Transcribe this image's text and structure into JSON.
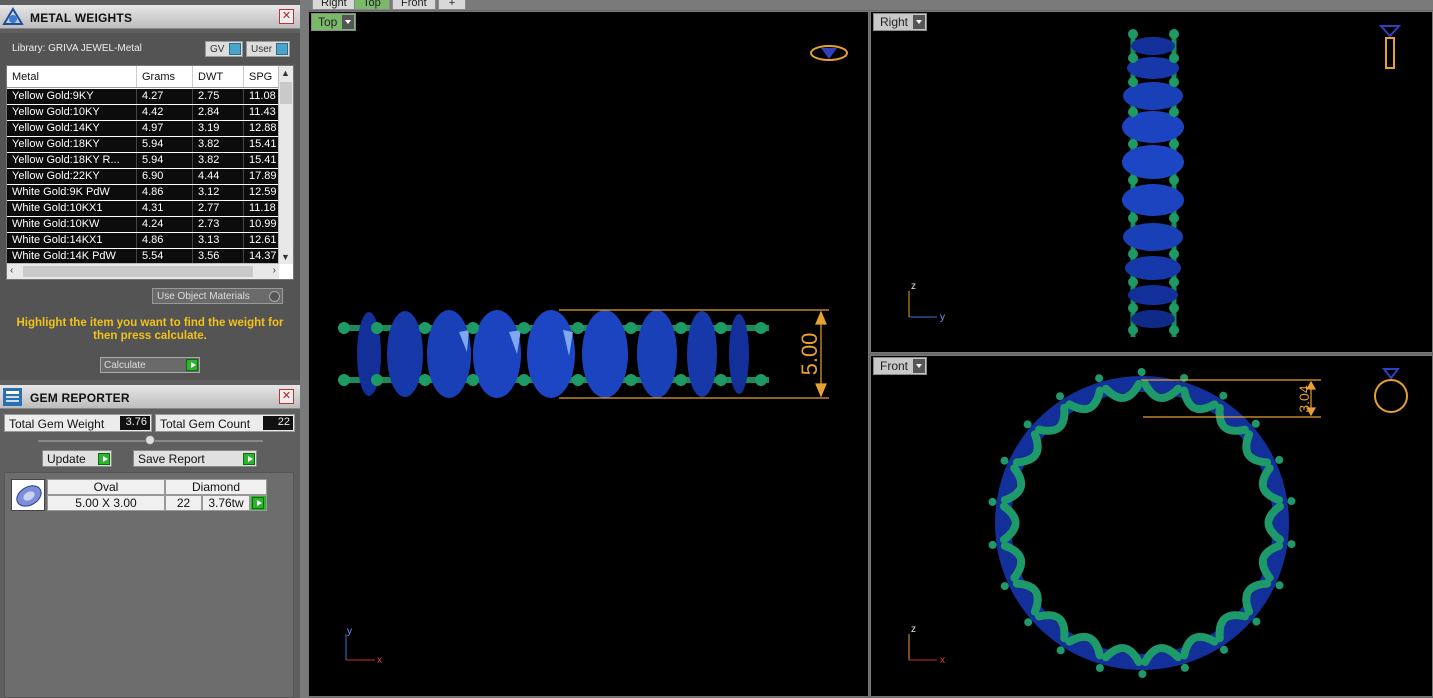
{
  "metal_panel": {
    "title": "METAL WEIGHTS",
    "library": "Library: GRIVA JEWEL-Metal",
    "toggle_gv": "GV",
    "toggle_user": "User",
    "headers": [
      "Metal",
      "Grams",
      "DWT",
      "SPG"
    ],
    "rows": [
      [
        "Yellow Gold:9KY",
        "4.27",
        "2.75",
        "11.08"
      ],
      [
        "Yellow Gold:10KY",
        "4.42",
        "2.84",
        "11.43"
      ],
      [
        "Yellow Gold:14KY",
        "4.97",
        "3.19",
        "12.88"
      ],
      [
        "Yellow Gold:18KY",
        "5.94",
        "3.82",
        "15.41"
      ],
      [
        "Yellow Gold:18KY R...",
        "5.94",
        "3.82",
        "15.41"
      ],
      [
        "Yellow Gold:22KY",
        "6.90",
        "4.44",
        "17.89"
      ],
      [
        "White Gold:9K PdW",
        "4.86",
        "3.12",
        "12.59"
      ],
      [
        "White Gold:10KX1",
        "4.31",
        "2.77",
        "11.18"
      ],
      [
        "White Gold:10KW",
        "4.24",
        "2.73",
        "10.99"
      ],
      [
        "White Gold:14KX1",
        "4.86",
        "3.13",
        "12.61"
      ],
      [
        "White Gold:14K PdW",
        "5.54",
        "3.56",
        "14.37"
      ]
    ],
    "use_object_materials": "Use Object Materials",
    "hint": "Highlight the item you want to find the weight for then press calculate.",
    "calculate": "Calculate"
  },
  "gem_panel": {
    "title": "GEM REPORTER",
    "total_weight_label": "Total Gem Weight",
    "total_weight": "3.76",
    "total_count_label": "Total Gem Count",
    "total_count": "22",
    "update": "Update",
    "save_report": "Save Report",
    "row": {
      "shape": "Oval",
      "size": "5.00 X 3.00",
      "material": "Diamond",
      "count": "22",
      "weight": "3.76tw"
    }
  },
  "tabs": [
    "Right",
    "Top",
    "Front"
  ],
  "viewports": {
    "top": {
      "label": "Top",
      "dimension": "5.00",
      "axis_y": "y",
      "axis_x": "x"
    },
    "right": {
      "label": "Right",
      "axis_z": "z",
      "axis_y": "y"
    },
    "front": {
      "label": "Front",
      "dimension": "3.04",
      "axis_z": "z",
      "axis_x": "x"
    }
  },
  "colors": {
    "accent_hint": "#f2c21a",
    "gem_blue": "#1a3fa8",
    "prong_green": "#1e8a5a",
    "dimension_orange": "#e8a030"
  }
}
